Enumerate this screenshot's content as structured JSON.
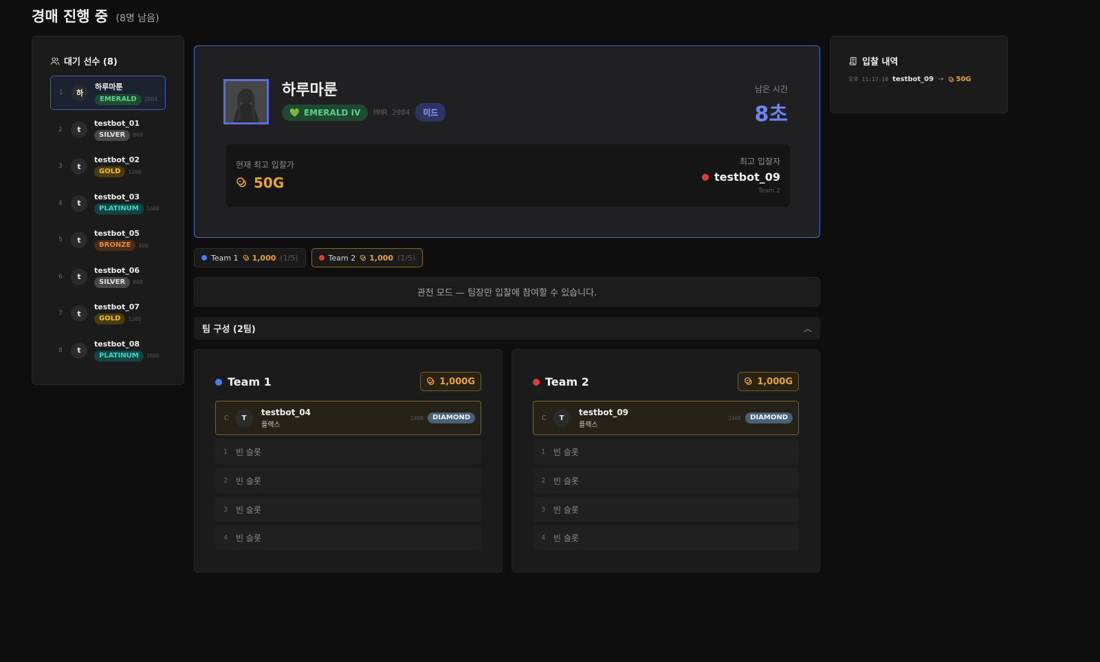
{
  "header": {
    "title": "경매 진행 중",
    "remaining": "(8명 남음)"
  },
  "waiting": {
    "title": "대기 선수 (8)",
    "players": [
      {
        "num": "1",
        "initial": "하",
        "name": "하루마룬",
        "tier": "EMERALD",
        "tier_class": "emerald",
        "mmr": "2084",
        "active": true
      },
      {
        "num": "2",
        "initial": "t",
        "name": "testbot_01",
        "tier": "SILVER",
        "tier_class": "silver",
        "mmr": "800"
      },
      {
        "num": "3",
        "initial": "t",
        "name": "testbot_02",
        "tier": "GOLD",
        "tier_class": "gold",
        "mmr": "1200"
      },
      {
        "num": "4",
        "initial": "t",
        "name": "testbot_03",
        "tier": "PLATINUM",
        "tier_class": "platinum",
        "mmr": "1600"
      },
      {
        "num": "5",
        "initial": "t",
        "name": "testbot_05",
        "tier": "BRONZE",
        "tier_class": "bronze",
        "mmr": "400"
      },
      {
        "num": "6",
        "initial": "t",
        "name": "testbot_06",
        "tier": "SILVER",
        "tier_class": "silver",
        "mmr": "800"
      },
      {
        "num": "7",
        "initial": "t",
        "name": "testbot_07",
        "tier": "GOLD",
        "tier_class": "gold",
        "mmr": "1200"
      },
      {
        "num": "8",
        "initial": "t",
        "name": "testbot_08",
        "tier": "PLATINUM",
        "tier_class": "platinum",
        "mmr": "1600"
      }
    ]
  },
  "auction": {
    "player_name": "하루마룬",
    "tier": "EMERALD IV",
    "mmr": "MMR 2084",
    "role": "미드",
    "time_label": "남은 시간",
    "time_value": "8초",
    "bid_label": "현재 최고 입찰가",
    "bid_amount": "50G",
    "bidder_label": "최고 입찰자",
    "bidder_name": "testbot_09",
    "bidder_team": "Team 2"
  },
  "chips": [
    {
      "team": "Team 1",
      "gold": "1,000",
      "slots": "(1/5)",
      "color": "#3f7fee"
    },
    {
      "team": "Team 2",
      "gold": "1,000",
      "slots": "(1/5)",
      "color": "#e23c3c"
    }
  ],
  "notice": "관전 모드 — 팀장만 입찰에 참여할 수 있습니다.",
  "composition": {
    "title": "팀 구성 (2팀)"
  },
  "teams": [
    {
      "name": "Team 1",
      "gold": "1,000G",
      "captain": {
        "mark": "C",
        "initial": "T",
        "name": "testbot_04",
        "role": "플렉스",
        "mmr": "2400",
        "tier": "DIAMOND"
      },
      "empty_label": "빈 슬롯",
      "slots": [
        "1",
        "2",
        "3",
        "4"
      ]
    },
    {
      "name": "Team 2",
      "gold": "1,000G",
      "captain": {
        "mark": "C",
        "initial": "T",
        "name": "testbot_09",
        "role": "플렉스",
        "mmr": "2400",
        "tier": "DIAMOND"
      },
      "empty_label": "빈 슬롯",
      "slots": [
        "1",
        "2",
        "3",
        "4"
      ]
    }
  ],
  "history": {
    "title": "입찰 내역",
    "entries": [
      {
        "time": "오후 11:17:10",
        "name": "testbot_09",
        "arrow": "→",
        "amount": "50G"
      }
    ]
  },
  "colors": {
    "accent": "#5b6ee0",
    "gold": "#e8a52e",
    "team1": "#3f7fee",
    "team2": "#e23c3c"
  }
}
